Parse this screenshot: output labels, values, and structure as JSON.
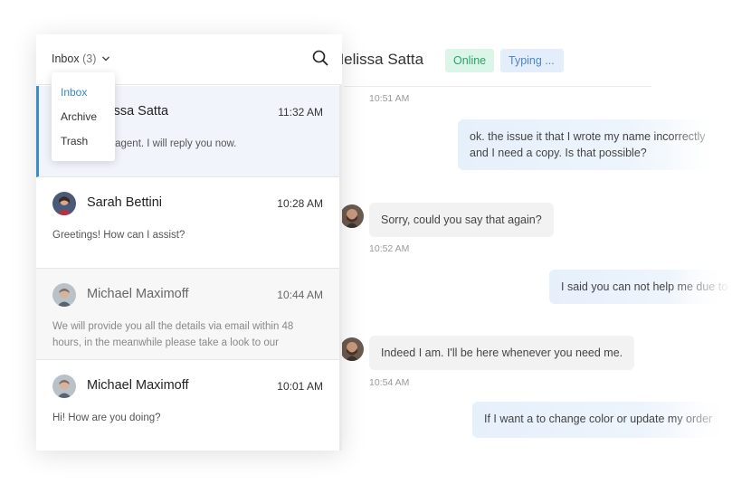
{
  "chat": {
    "contact_name": "Melissa Satta",
    "status_online": "Online",
    "status_typing": "Typing ...",
    "messages": [
      {
        "time": "10:51 AM"
      },
      {
        "text": "ok. the issue it that I wrote my name incorrectly and I need a copy. Is that possible?"
      },
      {
        "text": "Sorry, could you say that again?",
        "time": "10:52 AM"
      },
      {
        "text": "I said you can not help me due to"
      },
      {
        "text": "Indeed I am. I'll be here whenever you need me.",
        "time": "10:54 AM"
      },
      {
        "text": "If I want a to change color or update my order"
      }
    ]
  },
  "inbox": {
    "title": "Inbox",
    "count": "(3)",
    "dropdown": [
      "Inbox",
      "Archive",
      "Trash"
    ],
    "conversations": [
      {
        "name": "Melissa Satta",
        "time": "11:32 AM",
        "snippet": "I'm a human agent. I will reply you now."
      },
      {
        "name": "Sarah Bettini",
        "time": "10:28 AM",
        "snippet": "Greetings! How can I assist?"
      },
      {
        "name": "Michael Maximoff",
        "time": "10:44 AM",
        "snippet": "We will provide you all the details via email within 48 hours, in the meanwhile please take a look to our"
      },
      {
        "name": "Michael Maximoff",
        "time": "10:01 AM",
        "snippet": "Hi! How are you doing?"
      }
    ]
  },
  "colors": {
    "accent": "#3c8cc6",
    "online_bg": "#dcf5e9",
    "online_text": "#2aa46b",
    "typing_bg": "#e4eefb",
    "typing_text": "#4b86c9",
    "outgoing_bubble": "#e6f0fb",
    "incoming_bubble": "#f2f2f3"
  },
  "icons": [
    "search-icon",
    "chevron-down-icon"
  ]
}
